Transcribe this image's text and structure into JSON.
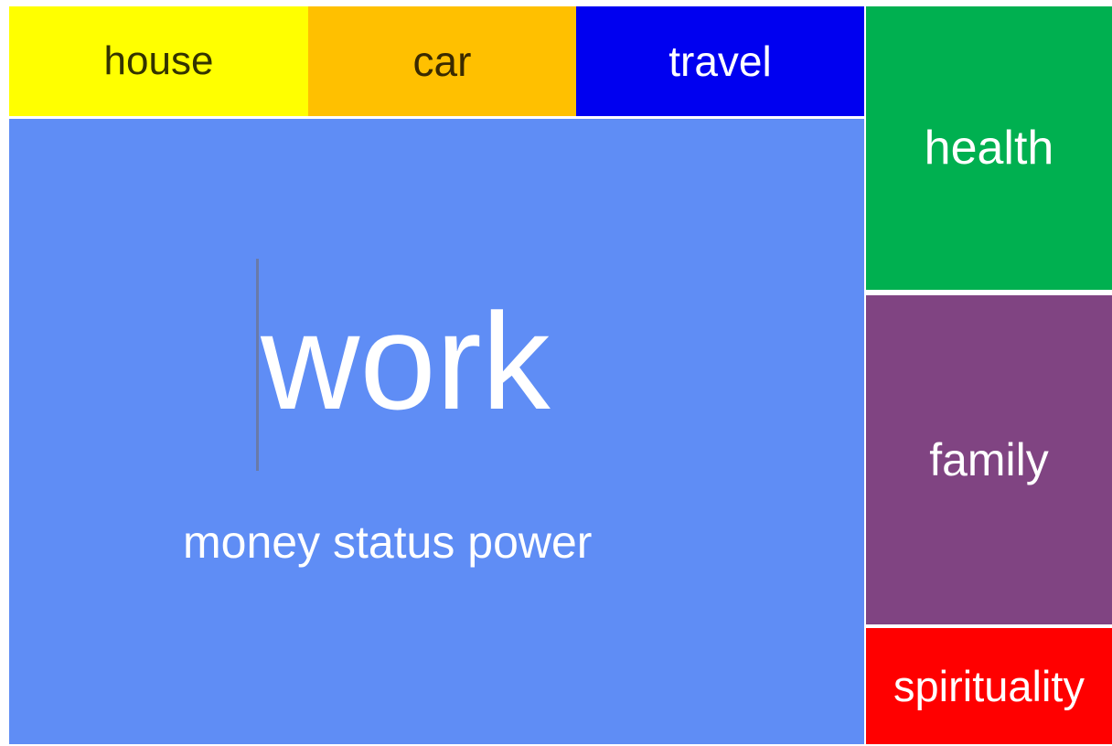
{
  "tiles": {
    "house": {
      "label": "house",
      "color": "#ffff00"
    },
    "car": {
      "label": "car",
      "color": "#ffc000"
    },
    "travel": {
      "label": "travel",
      "color": "#0000f0"
    },
    "work": {
      "label": "work",
      "subtitle": "money status power",
      "color": "#5f8df5"
    },
    "health": {
      "label": "health",
      "color": "#00b050"
    },
    "family": {
      "label": "family",
      "color": "#804482"
    },
    "spirituality": {
      "label": "spirituality",
      "color": "#ff0000"
    }
  }
}
